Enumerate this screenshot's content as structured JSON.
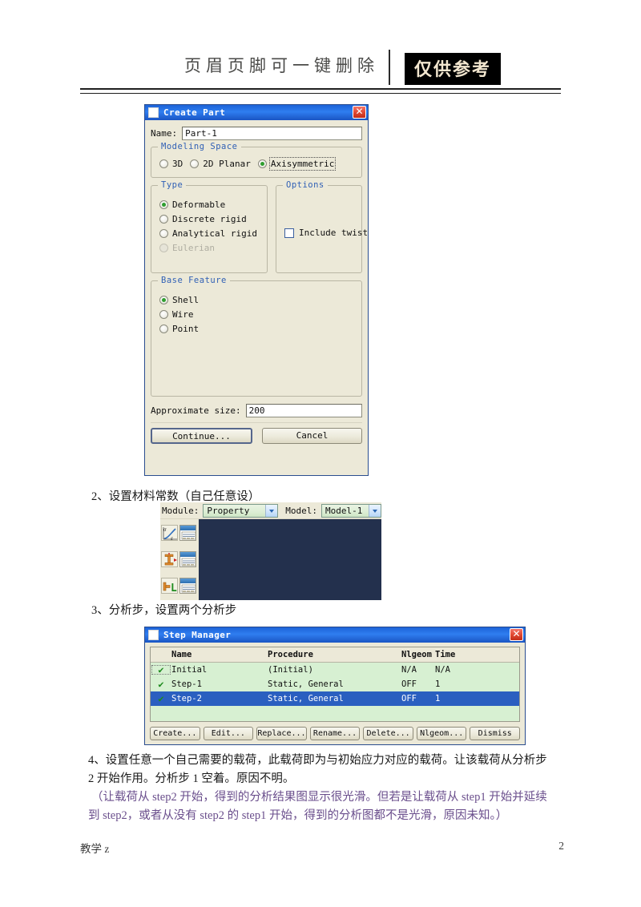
{
  "header": {
    "watermark_text": "页眉页脚可一键删除",
    "badge_text": "仅供参考"
  },
  "create_part_dialog": {
    "title": "Create Part",
    "close_label": "✕",
    "name_label": "Name:",
    "name_value": "Part-1",
    "modeling_space": {
      "title": "Modeling Space",
      "options": [
        {
          "label": "3D",
          "selected": false
        },
        {
          "label": "2D Planar",
          "selected": false
        },
        {
          "label": "Axisymmetric",
          "selected": true
        }
      ]
    },
    "type": {
      "title": "Type",
      "options": [
        {
          "label": "Deformable",
          "selected": true,
          "disabled": false
        },
        {
          "label": "Discrete rigid",
          "selected": false,
          "disabled": false
        },
        {
          "label": "Analytical rigid",
          "selected": false,
          "disabled": false
        },
        {
          "label": "Eulerian",
          "selected": false,
          "disabled": true
        }
      ]
    },
    "options": {
      "title": "Options",
      "include_twist_label": "Include twist",
      "include_twist_checked": false
    },
    "base_feature": {
      "title": "Base Feature",
      "options": [
        {
          "label": "Shell",
          "selected": true
        },
        {
          "label": "Wire",
          "selected": false
        },
        {
          "label": "Point",
          "selected": false
        }
      ]
    },
    "approximate_size_label": "Approximate size:",
    "approximate_size_value": "200",
    "continue_label": "Continue...",
    "cancel_label": "Cancel"
  },
  "step2": {
    "text": "2、设置材料常数（自己任意设）"
  },
  "module_bar": {
    "module_label": "Module:",
    "module_value": "Property",
    "model_label": "Model:",
    "model_value": "Model-1",
    "tool_icons": [
      {
        "name": "create-material-icon"
      },
      {
        "name": "material-manager-icon"
      },
      {
        "name": "create-section-icon"
      },
      {
        "name": "section-manager-icon"
      },
      {
        "name": "assign-section-icon"
      },
      {
        "name": "section-assignment-manager-icon"
      }
    ]
  },
  "step3": {
    "text": "3、分析步，设置两个分析步"
  },
  "step_manager_dialog": {
    "title": "Step Manager",
    "close_label": "✕",
    "columns": [
      "Name",
      "Procedure",
      "Nlgeom",
      "Time"
    ],
    "check_glyph": "✔",
    "rows": [
      {
        "name": "Initial",
        "procedure": "(Initial)",
        "nlgeom": "N/A",
        "time": "N/A",
        "selected": false
      },
      {
        "name": "Step-1",
        "procedure": "Static, General",
        "nlgeom": "OFF",
        "time": "1",
        "selected": false
      },
      {
        "name": "Step-2",
        "procedure": "Static, General",
        "nlgeom": "OFF",
        "time": "1",
        "selected": true
      }
    ],
    "buttons": [
      "Create...",
      "Edit...",
      "Replace...",
      "Rename...",
      "Delete...",
      "Nlgeom...",
      "Dismiss"
    ]
  },
  "step4": {
    "line1": "4、设置任意一个自己需要的载荷，此载荷即为与初始应力对应的载荷。让该载荷从分析步",
    "line2": "2 开始作用。分析步 1 空着。原因不明。"
  },
  "note": {
    "line1": "（让载荷从 step2 开始，得到的分析结果图显示很光滑。但若是让载荷从 step1 开始并延续",
    "line2": "到 step2，或者从没有 step2 的 step1 开始，得到的分析图都不是光滑，原因未知。）"
  },
  "footer": {
    "left": "教学 z",
    "page_number": "2"
  },
  "colors": {
    "title_blue": "#2f7ef0",
    "group_title": "#2f5fb5",
    "dialog_face": "#ece9d8",
    "table_green": "#d7f0d2",
    "row_selected": "#2a5fc0",
    "viewport": "#23304d",
    "note_purple": "#6a4e8c",
    "badge_bg": "#000000"
  }
}
